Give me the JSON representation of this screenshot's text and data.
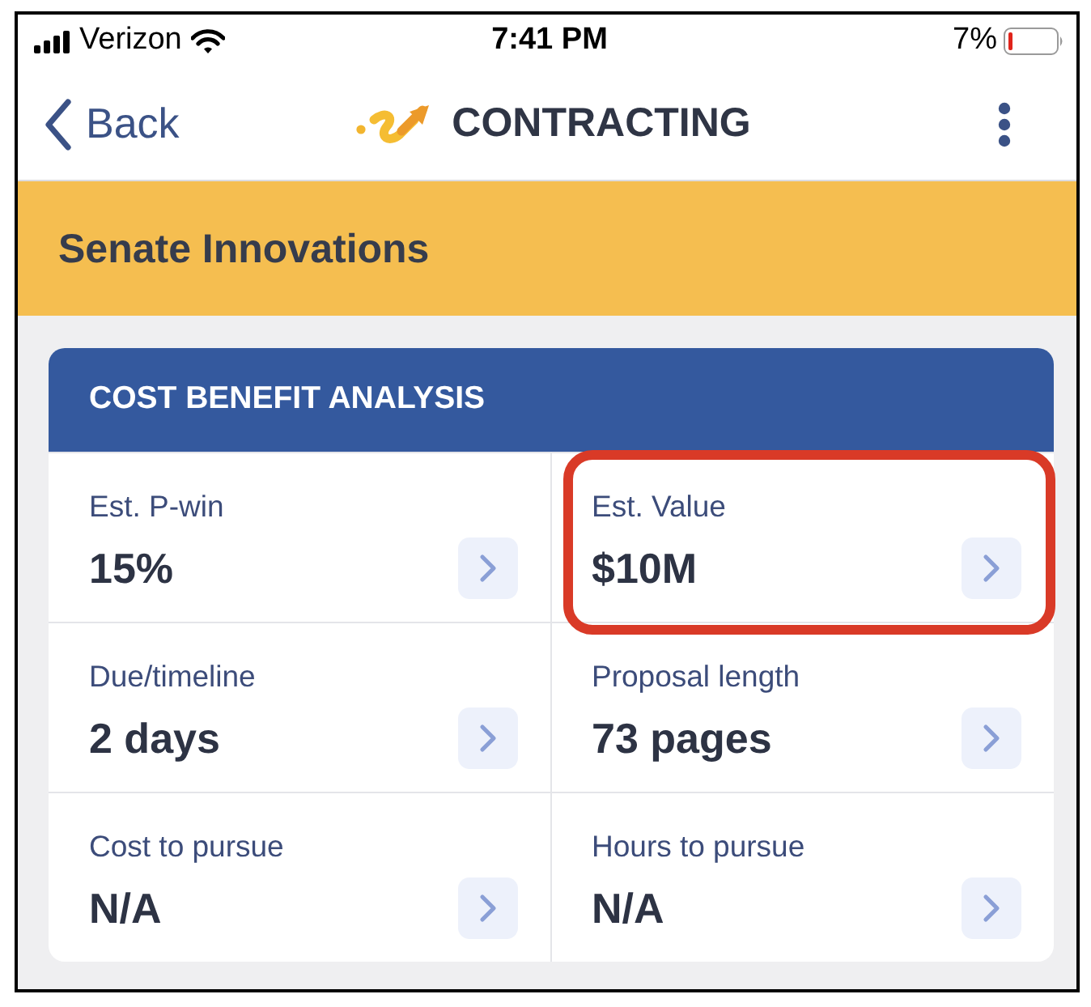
{
  "status_bar": {
    "carrier": "Verizon",
    "time": "7:41 PM",
    "battery": "7%"
  },
  "nav_bar": {
    "back_label": "Back",
    "title": "CONTRACTING"
  },
  "banner": {
    "title": "Senate Innovations"
  },
  "card": {
    "title": "COST BENEFIT ANALYSIS",
    "cells": [
      {
        "label": "Est. P-win",
        "value": "15%",
        "highlighted": false
      },
      {
        "label": "Est. Value",
        "value": "$10M",
        "highlighted": true
      },
      {
        "label": "Due/timeline",
        "value": "2 days",
        "highlighted": false
      },
      {
        "label": "Proposal length",
        "value": "73 pages",
        "highlighted": false
      },
      {
        "label": "Cost to pursue",
        "value": "N/A",
        "highlighted": false
      },
      {
        "label": "Hours to pursue",
        "value": "N/A",
        "highlighted": false
      }
    ]
  }
}
